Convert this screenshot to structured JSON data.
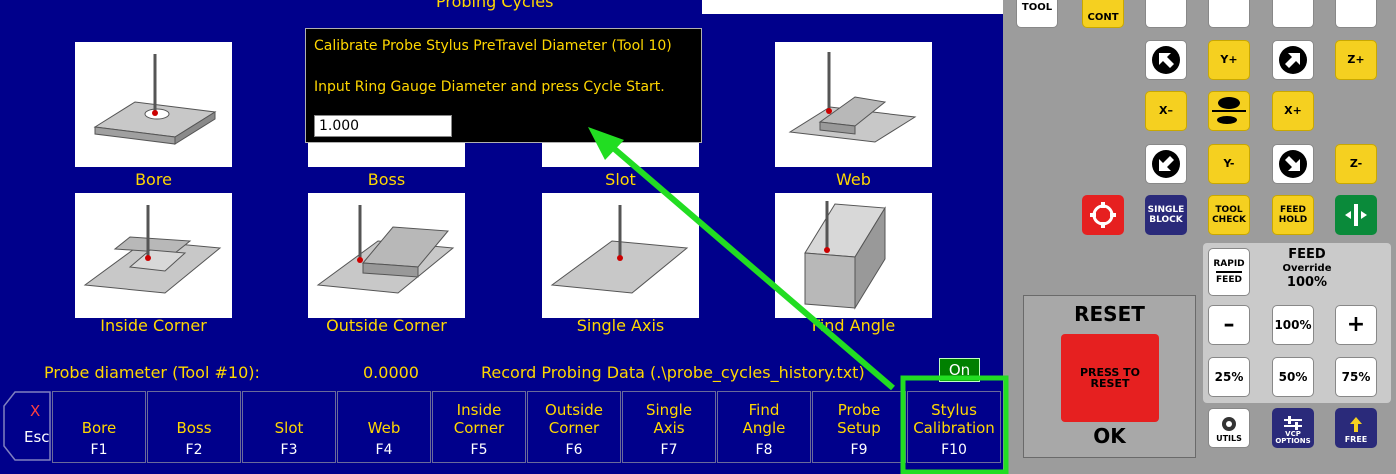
{
  "main": {
    "title": "Probing Cycles",
    "cycles": [
      {
        "label": "Bore"
      },
      {
        "label": "Boss"
      },
      {
        "label": "Slot"
      },
      {
        "label": "Web"
      },
      {
        "label": "Inside Corner"
      },
      {
        "label": "Outside Corner"
      },
      {
        "label": "Single Axis"
      },
      {
        "label": "Find Angle"
      }
    ],
    "probe_diameter_label": "Probe diameter (Tool #10):",
    "probe_diameter_value": "0.0000",
    "record_label": "Record Probing Data (.\\probe_cycles_history.txt)",
    "record_state": "On"
  },
  "dialog": {
    "title": "Calibrate Probe Stylus PreTravel Diameter (Tool 10)",
    "instruction": "Input Ring Gauge Diameter and press Cycle Start.",
    "input_value": "1.000"
  },
  "fkeys": {
    "esc_x": "X",
    "esc_label": "Esc",
    "items": [
      {
        "line1": "Bore",
        "line2": "",
        "fn": "F1"
      },
      {
        "line1": "Boss",
        "line2": "",
        "fn": "F2"
      },
      {
        "line1": "Slot",
        "line2": "",
        "fn": "F3"
      },
      {
        "line1": "Web",
        "line2": "",
        "fn": "F4"
      },
      {
        "line1": "Inside",
        "line2": "Corner",
        "fn": "F5"
      },
      {
        "line1": "Outside",
        "line2": "Corner",
        "fn": "F6"
      },
      {
        "line1": "Single",
        "line2": "Axis",
        "fn": "F7"
      },
      {
        "line1": "Find",
        "line2": "Angle",
        "fn": "F8"
      },
      {
        "line1": "Probe",
        "line2": "Setup",
        "fn": "F9"
      },
      {
        "line1": "Stylus",
        "line2": "Calibration",
        "fn": "F10"
      }
    ]
  },
  "panel": {
    "tool_label": "TOOL",
    "cont_label": "CONT",
    "y_plus": "Y+",
    "z_plus": "Z+",
    "x_minus": "X–",
    "x_plus": "X+",
    "y_minus": "Y-",
    "z_minus": "Z-",
    "single_block": "SINGLE BLOCK",
    "tool_check": "TOOL CHECK",
    "feed_hold": "FEED HOLD",
    "rapid_feed_1": "RAPID",
    "rapid_feed_2": "FEED",
    "feed_override_1": "FEED",
    "feed_override_2": "Override",
    "feed_override_value": "100%",
    "minus": "–",
    "plus": "+",
    "pct_100": "100%",
    "pct_25": "25%",
    "pct_50": "50%",
    "pct_75": "75%",
    "reset_title": "RESET",
    "press_to_reset": "PRESS TO RESET",
    "ok": "OK",
    "utils": "UTILS",
    "vcp_options": "VCP OPTIONS",
    "free": "FREE"
  },
  "annotation_color": "#22dd22",
  "colors": {
    "background": "#00008b",
    "accent": "#ffd700"
  }
}
